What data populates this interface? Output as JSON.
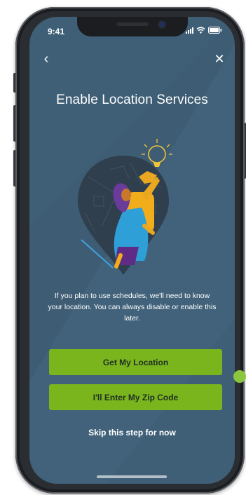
{
  "status_bar": {
    "time": "9:41"
  },
  "nav": {
    "back_glyph": "‹",
    "close_glyph": "✕"
  },
  "title": "Enable Location Services",
  "description": "If you plan to use schedules, we'll need to know your location. You can always disable or enable this later.",
  "actions": {
    "primary_label": "Get My Location",
    "secondary_label": "I'll Enter My Zip Code",
    "skip_label": "Skip this step for now"
  },
  "icons": [
    "back-chevron-icon",
    "close-icon",
    "signal-icon",
    "wifi-icon",
    "battery-icon",
    "lightbulb-icon",
    "location-pin-icon"
  ],
  "colors": {
    "screen_background": "#3f5f76",
    "accent_green": "#7ab51d",
    "button_text": "#1f2f24",
    "pin": "#2f3f4d",
    "lightbulb": "#f0c53a"
  }
}
